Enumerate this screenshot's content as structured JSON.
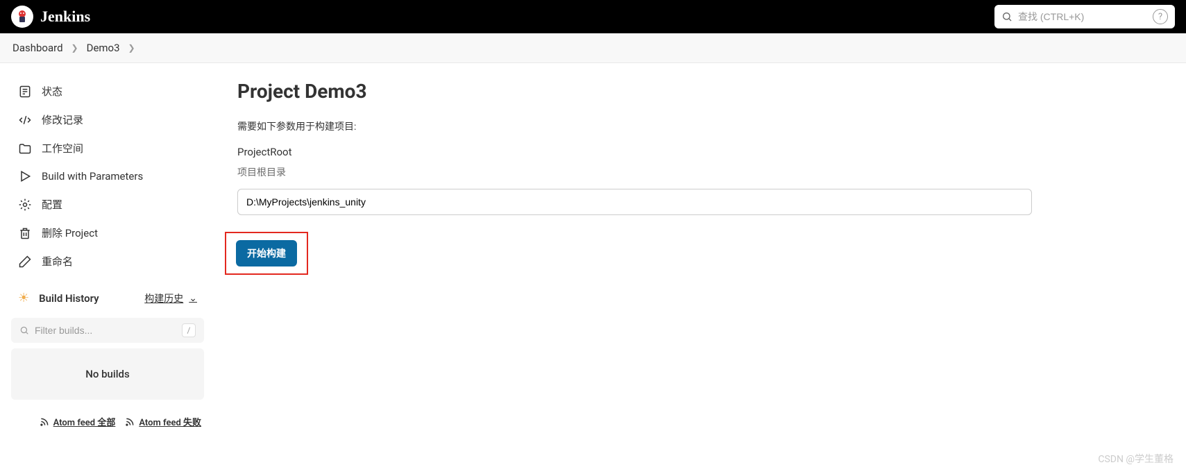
{
  "header": {
    "title": "Jenkins",
    "search_placeholder": "查找 (CTRL+K)"
  },
  "breadcrumb": {
    "items": [
      "Dashboard",
      "Demo3"
    ]
  },
  "sidebar": {
    "items": [
      {
        "label": "状态"
      },
      {
        "label": "修改记录"
      },
      {
        "label": "工作空间"
      },
      {
        "label": "Build with Parameters"
      },
      {
        "label": "配置"
      },
      {
        "label": "删除 Project"
      },
      {
        "label": "重命名"
      }
    ]
  },
  "build_history": {
    "title": "Build History",
    "trend_label": "构建历史",
    "filter_placeholder": "Filter builds...",
    "no_builds": "No builds",
    "feed_all": "Atom feed 全部",
    "feed_fail": "Atom feed 失败"
  },
  "main": {
    "title": "Project Demo3",
    "param_desc": "需要如下参数用于构建项目:",
    "param_name": "ProjectRoot",
    "param_hint": "项目根目录",
    "param_value": "D:\\MyProjects\\jenkins_unity",
    "build_button": "开始构建"
  },
  "watermark": "CSDN @学生董格"
}
